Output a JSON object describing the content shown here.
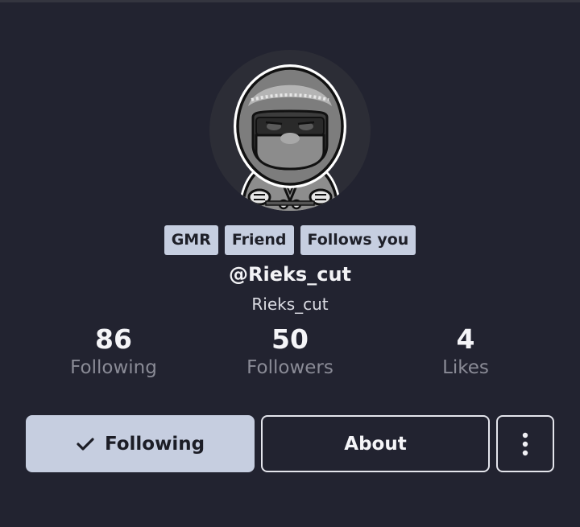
{
  "profile": {
    "tags": [
      "GMR",
      "Friend",
      "Follows you"
    ],
    "handle": "@Rieks_cut",
    "display_name": "Rieks_cut"
  },
  "stats": [
    {
      "value": "86",
      "label": "Following"
    },
    {
      "value": "50",
      "label": "Followers"
    },
    {
      "value": "4",
      "label": "Likes"
    }
  ],
  "actions": {
    "following_label": "Following",
    "about_label": "About"
  },
  "icons": {
    "following": "checkmark-icon",
    "more": "vertical-ellipsis-icon",
    "avatar": "hooded-character-avatar"
  },
  "colors": {
    "background": "#222330",
    "tag_background": "#c6cee0",
    "primary_button": "#c6cee0",
    "muted_text": "#8a8b96"
  }
}
